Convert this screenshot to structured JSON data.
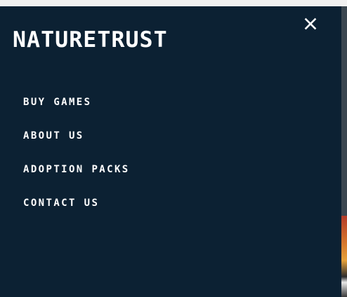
{
  "menu": {
    "brand": "NATURETRUST",
    "close_icon": "close-icon",
    "items": [
      {
        "label": "BUY GAMES"
      },
      {
        "label": "ABOUT US"
      },
      {
        "label": "ADOPTION PACKS"
      },
      {
        "label": "CONTACT US"
      }
    ]
  },
  "colors": {
    "drawer_background": "#0c2133",
    "text": "#ffffff",
    "page_background": "#f1f1f1"
  }
}
